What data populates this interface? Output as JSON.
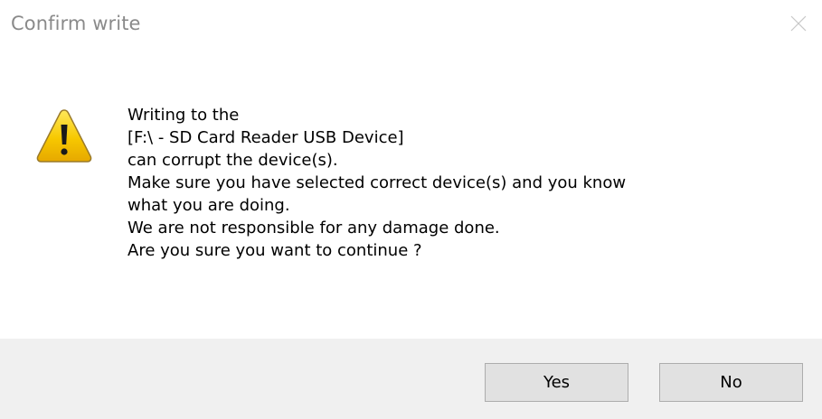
{
  "window": {
    "title": "Confirm write",
    "close_icon": "close-icon"
  },
  "dialog": {
    "icon": "warning-icon",
    "message_lines": [
      "Writing to the",
      "[F:\\ - SD Card Reader USB Device]",
      "can corrupt the device(s).",
      "Make sure you have selected correct device(s) and you know",
      "what you are doing.",
      "We are not responsible for any damage done.",
      "Are you sure you want to continue ?"
    ]
  },
  "buttons": {
    "yes_label": "Yes",
    "no_label": "No"
  },
  "colors": {
    "footer_background": "#f0f0f0",
    "button_background": "#e1e1e1",
    "warning_yellow": "#f5c400"
  }
}
